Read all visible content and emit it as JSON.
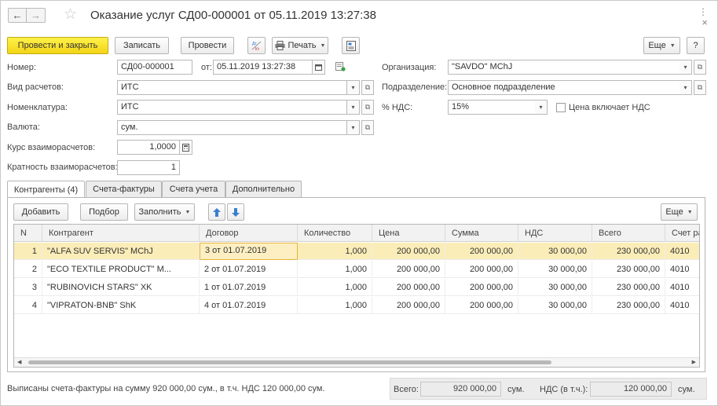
{
  "window": {
    "title": "Оказание услуг СД00-000001 от 05.11.2019 13:27:38",
    "close_glyph": "×",
    "more_glyph": "⋮"
  },
  "toolbar": {
    "post_close": "Провести и закрыть",
    "save": "Записать",
    "post": "Провести",
    "dtkt": "ДтКт",
    "print": "Печать",
    "more": "Еще",
    "help": "?"
  },
  "form": {
    "number_label": "Номер:",
    "number_value": "СД00-000001",
    "date_label": "от:",
    "date_value": "05.11.2019 13:27:38",
    "org_label": "Организация:",
    "org_value": "\"SAVDO\" MChJ",
    "calc_type_label": "Вид расчетов:",
    "calc_type_value": "ИТС",
    "division_label": "Подразделение:",
    "division_value": "Основное подразделение",
    "nomenclature_label": "Номенклатура:",
    "nomenclature_value": "ИТС",
    "vat_label": "% НДС:",
    "vat_value": "15%",
    "vat_included_label": "Цена включает НДС",
    "currency_label": "Валюта:",
    "currency_value": "сум.",
    "rate_label": "Курс взаиморасчетов:",
    "rate_value": "1,0000",
    "multiplicity_label": "Кратность взаиморасчетов:",
    "multiplicity_value": "1"
  },
  "tabs": [
    {
      "label": "Контрагенты (4)",
      "active": true
    },
    {
      "label": "Счета-фактуры",
      "active": false
    },
    {
      "label": "Счета учета",
      "active": false
    },
    {
      "label": "Дополнительно",
      "active": false
    }
  ],
  "table_toolbar": {
    "add": "Добавить",
    "select": "Подбор",
    "fill": "Заполнить",
    "more": "Еще"
  },
  "table": {
    "columns": [
      "N",
      "Контрагент",
      "Договор",
      "Количество",
      "Цена",
      "Сумма",
      "НДС",
      "Всего",
      "Счет ра"
    ],
    "rows": [
      [
        "1",
        "\"ALFA SUV SERVIS\" MChJ",
        "3 от 01.07.2019",
        "1,000",
        "200 000,00",
        "200 000,00",
        "30 000,00",
        "230 000,00",
        "4010"
      ],
      [
        "2",
        "\"ECO TEXTILE PRODUCT\" M...",
        "2 от 01.07.2019",
        "1,000",
        "200 000,00",
        "200 000,00",
        "30 000,00",
        "230 000,00",
        "4010"
      ],
      [
        "3",
        "\"RUBINOVICH STARS\" XK",
        "1 от 01.07.2019",
        "1,000",
        "200 000,00",
        "200 000,00",
        "30 000,00",
        "230 000,00",
        "4010"
      ],
      [
        "4",
        "\"VIPRATON-BNB\" ShK",
        "4 от 01.07.2019",
        "1,000",
        "200 000,00",
        "200 000,00",
        "30 000,00",
        "230 000,00",
        "4010"
      ]
    ]
  },
  "footer": {
    "invoice_text": "Выписаны счета-фактуры на сумму 920 000,00 сум., в т.ч. НДС 120 000,00 сум.",
    "total_label": "Всего:",
    "total_value": "920 000,00",
    "total_currency": "сум.",
    "vat_label": "НДС (в т.ч.):",
    "vat_value": "120 000,00",
    "vat_currency": "сум."
  },
  "colors": {
    "primary_button": "#f3d416",
    "selected_row": "#fbedb8",
    "arrow_blue": "#3a7fd0"
  }
}
